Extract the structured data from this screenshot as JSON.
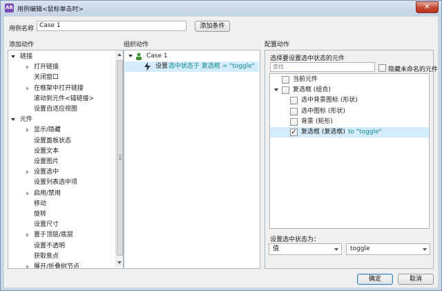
{
  "window": {
    "title": "用例编辑<鼠标单击时>",
    "close_label": "✕",
    "app_icon_text": "AR"
  },
  "case_name": {
    "label": "用例名称",
    "value": "Case 1",
    "add_condition_button": "添加条件"
  },
  "add_actions": {
    "heading": "添加动作",
    "items": [
      {
        "label": "链接",
        "level": 0,
        "expander": "down"
      },
      {
        "label": "打开链接",
        "level": 1,
        "expander": "right"
      },
      {
        "label": "关闭窗口",
        "level": 1,
        "expander": ""
      },
      {
        "label": "在框架中打开链接",
        "level": 1,
        "expander": "right"
      },
      {
        "label": "滚动到元件<锚链接>",
        "level": 1,
        "expander": ""
      },
      {
        "label": "设置自适应视图",
        "level": 1,
        "expander": ""
      },
      {
        "label": "元件",
        "level": 0,
        "expander": "down"
      },
      {
        "label": "显示/隐藏",
        "level": 1,
        "expander": "right"
      },
      {
        "label": "设置面板状态",
        "level": 1,
        "expander": ""
      },
      {
        "label": "设置文本",
        "level": 1,
        "expander": ""
      },
      {
        "label": "设置图片",
        "level": 1,
        "expander": ""
      },
      {
        "label": "设置选中",
        "level": 1,
        "expander": "right"
      },
      {
        "label": "设置列表选中项",
        "level": 1,
        "expander": ""
      },
      {
        "label": "启用/禁用",
        "level": 1,
        "expander": "right"
      },
      {
        "label": "移动",
        "level": 1,
        "expander": ""
      },
      {
        "label": "旋转",
        "level": 1,
        "expander": ""
      },
      {
        "label": "设置尺寸",
        "level": 1,
        "expander": ""
      },
      {
        "label": "置于顶层/底层",
        "level": 1,
        "expander": "right"
      },
      {
        "label": "设置不透明",
        "level": 1,
        "expander": ""
      },
      {
        "label": "获取焦点",
        "level": 1,
        "expander": ""
      },
      {
        "label": "展开/折叠树节点",
        "level": 1,
        "expander": "right"
      }
    ]
  },
  "organize_actions": {
    "heading": "组织动作",
    "case_label": "Case 1",
    "action_prefix": "设置",
    "action_detail": "选中状态于 复选框 = \"toggle\""
  },
  "configure_actions": {
    "heading": "配置动作",
    "subheading": "选择要设置选中状态的元件",
    "search_placeholder": "查找",
    "hide_unnamed_label": "隐藏未命名的元件",
    "hide_unnamed_checked": false,
    "tree": [
      {
        "label": "当前元件",
        "level": 0,
        "expander": "",
        "checked": false,
        "selected": false
      },
      {
        "label": "复选框 (组合)",
        "level": 0,
        "expander": "down",
        "checked": false,
        "selected": false
      },
      {
        "label": "选中背景图标 (形状)",
        "level": 1,
        "expander": "",
        "checked": false,
        "selected": false
      },
      {
        "label": "选中图标 (形状)",
        "level": 1,
        "expander": "",
        "checked": false,
        "selected": false
      },
      {
        "label": "背景 (矩形)",
        "level": 1,
        "expander": "",
        "checked": false,
        "selected": false
      },
      {
        "label": "复选框 (复选框)",
        "suffix": " to \"toggle\"",
        "level": 1,
        "expander": "",
        "checked": true,
        "selected": true
      }
    ],
    "set_state_label": "设置选中状态为：",
    "value_type": "值",
    "value": "toggle"
  },
  "footer": {
    "ok_button": "确定",
    "cancel_button": "取消"
  },
  "colors": {
    "selection": "#d4ecfb",
    "action_teal": "#0f8b8d",
    "lightning": "#2f3b4d",
    "person_icon": "#3a8f2f"
  }
}
